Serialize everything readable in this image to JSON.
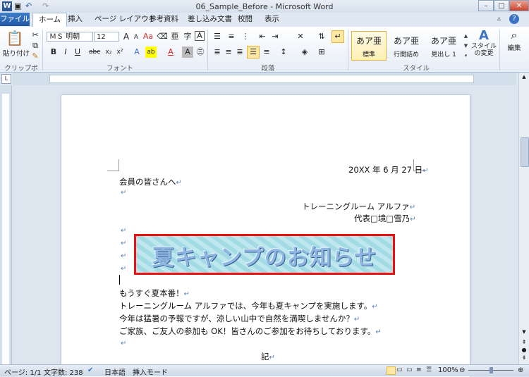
{
  "window": {
    "title": "06_Sample_Before - Microsoft Word"
  },
  "tabs": {
    "file": "ファイル",
    "items": [
      "ホーム",
      "挿入",
      "ページ レイアウト",
      "参考資料",
      "差し込み文書",
      "校閲",
      "表示"
    ]
  },
  "ribbon": {
    "clipboard": {
      "paste": "貼り付け",
      "label": "クリップボード"
    },
    "font": {
      "name": "ＭＳ 明朝",
      "size": "12",
      "label": "フォント"
    },
    "paragraph": {
      "label": "段落"
    },
    "styles": {
      "items": [
        {
          "sample": "あア亜",
          "name": "標準"
        },
        {
          "sample": "あア亜",
          "name": "行間詰め"
        },
        {
          "sample": "あア亜",
          "name": "見出し 1"
        }
      ],
      "change": "スタイルの変更",
      "label": "スタイル"
    },
    "editing": {
      "label": "編集"
    }
  },
  "document": {
    "date": "20XX 年 6 月 27 日",
    "to": "会員の皆さんへ",
    "org": "トレーニングルーム アルファ",
    "rep": "代表□境□雪乃",
    "wordart": "夏キャンプのお知らせ",
    "body": [
      "もうすぐ夏本番！",
      "トレーニングルーム アルファでは、今年も夏キャンプを実施します。",
      "今年は猛暑の予報ですが、涼しい山中で自然を満喫しませんか？",
      "ご家族、ご友人の参加も OK！皆さんのご参加をお待ちしております。"
    ],
    "ki": "記"
  },
  "status": {
    "page": "ページ: 1/1",
    "words": "文字数: 238",
    "lang": "日本語",
    "mode": "挿入モード",
    "zoom": "100%"
  }
}
